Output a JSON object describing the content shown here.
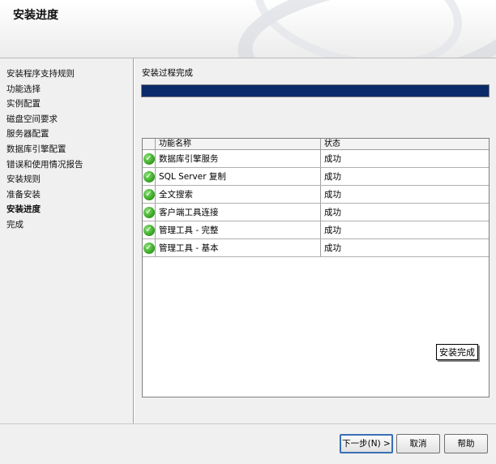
{
  "window": {
    "title": "安装进度"
  },
  "sidebar": {
    "items": [
      {
        "label": "安装程序支持规则",
        "active": false
      },
      {
        "label": "功能选择",
        "active": false
      },
      {
        "label": "实例配置",
        "active": false
      },
      {
        "label": "磁盘空间要求",
        "active": false
      },
      {
        "label": "服务器配置",
        "active": false
      },
      {
        "label": "数据库引擎配置",
        "active": false
      },
      {
        "label": "错误和使用情况报告",
        "active": false
      },
      {
        "label": "安装规则",
        "active": false
      },
      {
        "label": "准备安装",
        "active": false
      },
      {
        "label": "安装进度",
        "active": true
      },
      {
        "label": "完成",
        "active": false
      }
    ]
  },
  "main": {
    "status_text": "安装过程完成",
    "progress_percent": 100,
    "progress_color": "#0b2a6a",
    "table": {
      "headers": {
        "name": "功能名称",
        "status": "状态"
      },
      "rows": [
        {
          "name": "数据库引擎服务",
          "status": "成功",
          "icon": "success-check-icon"
        },
        {
          "name": "SQL Server 复制",
          "status": "成功",
          "icon": "success-check-icon"
        },
        {
          "name": "全文搜索",
          "status": "成功",
          "icon": "success-check-icon"
        },
        {
          "name": "客户端工具连接",
          "status": "成功",
          "icon": "success-check-icon"
        },
        {
          "name": "管理工具 - 完整",
          "status": "成功",
          "icon": "success-check-icon"
        },
        {
          "name": "管理工具 - 基本",
          "status": "成功",
          "icon": "success-check-icon"
        }
      ]
    },
    "tooltip": "安装完成"
  },
  "footer": {
    "next_label": "下一步(N) >",
    "cancel_label": "取消",
    "help_label": "帮助"
  }
}
